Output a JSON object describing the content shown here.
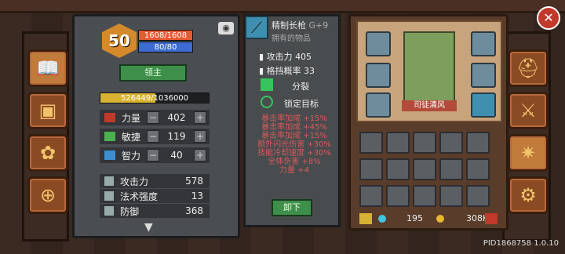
{
  "player": {
    "level": "50",
    "hp": "1608/1608",
    "mp": "80/80",
    "title_button": "领主",
    "exp": "526449/1036000"
  },
  "stats": [
    {
      "name": "力量",
      "value": "402"
    },
    {
      "name": "敏捷",
      "value": "119"
    },
    {
      "name": "智力",
      "value": "40"
    }
  ],
  "attributes": [
    {
      "name": "攻击力",
      "value": "578"
    },
    {
      "name": "法术强度",
      "value": "13"
    },
    {
      "name": "防御",
      "value": "368"
    }
  ],
  "weapon": {
    "name": "精制长枪",
    "plus": "G+9",
    "subtitle": "拥有的物品",
    "props": [
      {
        "label": "攻击力",
        "value": "405"
      },
      {
        "label": "格挡概率",
        "value": "33"
      }
    ],
    "skills": [
      "分裂",
      "锁定目标"
    ],
    "bonuses": [
      "暴击率加成 +15%",
      "暴击率加成 +45%",
      "暴击率加成 +15%",
      "额外闪光伤害 +30%",
      "技能冷却速度 +30%",
      "全体伤害 +8%",
      "力量 +4"
    ],
    "unequip": "卸下"
  },
  "hero": {
    "name": "司徒清风"
  },
  "currency": {
    "gems": "195",
    "gold": "308K"
  },
  "footer": {
    "pid": "PID1868758 1.0.10"
  },
  "colors": {
    "bonus_text": "#d65a5a",
    "hp_bar": "#e45a32",
    "mp_bar": "#3d6bd1",
    "exp_bar": "#d8b233",
    "accent": "#c17b3b"
  }
}
